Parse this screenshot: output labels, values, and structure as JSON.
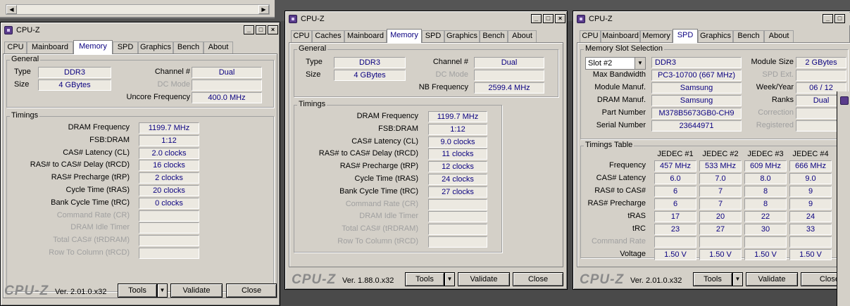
{
  "window1": {
    "title": "CPU-Z",
    "tabs": [
      "CPU",
      "Mainboard",
      "Memory",
      "SPD",
      "Graphics",
      "Bench",
      "About"
    ],
    "active_tab": "Memory",
    "general_title": "General",
    "type_label": "Type",
    "type_value": "DDR3",
    "size_label": "Size",
    "size_value": "4 GBytes",
    "channel_label": "Channel #",
    "channel_value": "Dual",
    "dcmode_label": "DC Mode",
    "dcmode_value": "",
    "uncore_label": "Uncore Frequency",
    "uncore_value": "400.0 MHz",
    "timings_title": "Timings",
    "timings": [
      {
        "label": "DRAM Frequency",
        "value": "1199.7 MHz",
        "disabled": false
      },
      {
        "label": "FSB:DRAM",
        "value": "1:12",
        "disabled": false
      },
      {
        "label": "CAS# Latency (CL)",
        "value": "2.0 clocks",
        "disabled": false
      },
      {
        "label": "RAS# to CAS# Delay (tRCD)",
        "value": "16 clocks",
        "disabled": false
      },
      {
        "label": "RAS# Precharge (tRP)",
        "value": "2 clocks",
        "disabled": false
      },
      {
        "label": "Cycle Time (tRAS)",
        "value": "20 clocks",
        "disabled": false
      },
      {
        "label": "Bank Cycle Time (tRC)",
        "value": "0 clocks",
        "disabled": false
      },
      {
        "label": "Command Rate (CR)",
        "value": "",
        "disabled": true
      },
      {
        "label": "DRAM Idle Timer",
        "value": "",
        "disabled": true
      },
      {
        "label": "Total CAS# (tRDRAM)",
        "value": "",
        "disabled": true
      },
      {
        "label": "Row To Column (tRCD)",
        "value": "",
        "disabled": true
      }
    ],
    "logo": "CPU-Z",
    "version": "Ver. 2.01.0.x32",
    "tools_label": "Tools",
    "validate_label": "Validate",
    "close_label": "Close"
  },
  "window2": {
    "title": "CPU-Z",
    "tabs": [
      "CPU",
      "Caches",
      "Mainboard",
      "Memory",
      "SPD",
      "Graphics",
      "Bench",
      "About"
    ],
    "active_tab": "Memory",
    "general_title": "General",
    "type_label": "Type",
    "type_value": "DDR3",
    "size_label": "Size",
    "size_value": "4 GBytes",
    "channel_label": "Channel #",
    "channel_value": "Dual",
    "dcmode_label": "DC Mode",
    "dcmode_value": "",
    "nb_label": "NB Frequency",
    "nb_value": "2599.4 MHz",
    "timings_title": "Timings",
    "timings": [
      {
        "label": "DRAM Frequency",
        "value": "1199.7 MHz",
        "disabled": false
      },
      {
        "label": "FSB:DRAM",
        "value": "1:12",
        "disabled": false
      },
      {
        "label": "CAS# Latency (CL)",
        "value": "9.0 clocks",
        "disabled": false
      },
      {
        "label": "RAS# to CAS# Delay (tRCD)",
        "value": "11 clocks",
        "disabled": false
      },
      {
        "label": "RAS# Precharge (tRP)",
        "value": "12 clocks",
        "disabled": false
      },
      {
        "label": "Cycle Time (tRAS)",
        "value": "24 clocks",
        "disabled": false
      },
      {
        "label": "Bank Cycle Time (tRC)",
        "value": "27 clocks",
        "disabled": false
      },
      {
        "label": "Command Rate (CR)",
        "value": "",
        "disabled": true
      },
      {
        "label": "DRAM Idle Timer",
        "value": "",
        "disabled": true
      },
      {
        "label": "Total CAS# (tRDRAM)",
        "value": "",
        "disabled": true
      },
      {
        "label": "Row To Column (tRCD)",
        "value": "",
        "disabled": true
      }
    ],
    "logo": "CPU-Z",
    "version": "Ver. 1.88.0.x32",
    "tools_label": "Tools",
    "validate_label": "Validate",
    "close_label": "Close"
  },
  "window3": {
    "title": "CPU-Z",
    "tabs": [
      "CPU",
      "Mainboard",
      "Memory",
      "SPD",
      "Graphics",
      "Bench",
      "About"
    ],
    "active_tab": "SPD",
    "slot_group_title": "Memory Slot Selection",
    "slot_value": "Slot #2",
    "slot_type": "DDR3",
    "module_size_label": "Module Size",
    "module_size_value": "2 GBytes",
    "max_bw_label": "Max Bandwidth",
    "max_bw_value": "PC3-10700 (667 MHz)",
    "spd_ext_label": "SPD Ext.",
    "spd_ext_value": "",
    "module_manuf_label": "Module Manuf.",
    "module_manuf_value": "Samsung",
    "week_year_label": "Week/Year",
    "week_year_value": "06 / 12",
    "dram_manuf_label": "DRAM Manuf.",
    "dram_manuf_value": "Samsung",
    "ranks_label": "Ranks",
    "ranks_value": "Dual",
    "part_label": "Part Number",
    "part_value": "M378B5673GB0-CH9",
    "correction_label": "Correction",
    "correction_value": "",
    "serial_label": "Serial Number",
    "serial_value": "23644971",
    "registered_label": "Registered",
    "registered_value": "",
    "timings_table_title": "Timings Table",
    "jedec_headers": [
      "JEDEC #1",
      "JEDEC #2",
      "JEDEC #3",
      "JEDEC #4"
    ],
    "timing_rows": [
      {
        "label": "Frequency",
        "values": [
          "457 MHz",
          "533 MHz",
          "609 MHz",
          "666 MHz"
        ],
        "disabled": false
      },
      {
        "label": "CAS# Latency",
        "values": [
          "6.0",
          "7.0",
          "8.0",
          "9.0"
        ],
        "disabled": false
      },
      {
        "label": "RAS# to CAS#",
        "values": [
          "6",
          "7",
          "8",
          "9"
        ],
        "disabled": false
      },
      {
        "label": "RAS# Precharge",
        "values": [
          "6",
          "7",
          "8",
          "9"
        ],
        "disabled": false
      },
      {
        "label": "tRAS",
        "values": [
          "17",
          "20",
          "22",
          "24"
        ],
        "disabled": false
      },
      {
        "label": "tRC",
        "values": [
          "23",
          "27",
          "30",
          "33"
        ],
        "disabled": false
      },
      {
        "label": "Command Rate",
        "values": [
          "",
          "",
          "",
          ""
        ],
        "disabled": true
      },
      {
        "label": "Voltage",
        "values": [
          "1.50 V",
          "1.50 V",
          "1.50 V",
          "1.50 V"
        ],
        "disabled": false
      }
    ],
    "logo": "CPU-Z",
    "version": "Ver. 2.01.0.x32",
    "tools_label": "Tools",
    "validate_label": "Validate",
    "close_label": "Close"
  },
  "window_controls": {
    "minimize": "_",
    "maximize": "□",
    "close": "×"
  },
  "glyphs": {
    "left_arrow": "◀",
    "right_arrow": "▶",
    "dropdown_arrow": "▼"
  }
}
